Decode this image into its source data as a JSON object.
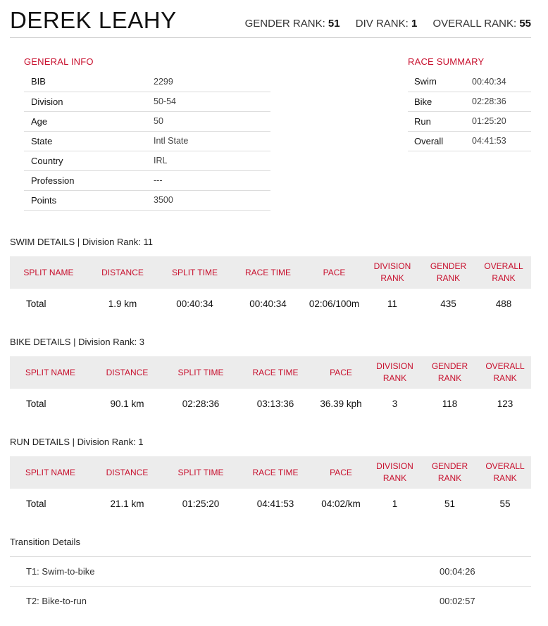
{
  "athlete": {
    "name": "DEREK LEAHY",
    "gender_rank_label": "GENDER RANK:",
    "gender_rank": "51",
    "div_rank_label": "DIV RANK:",
    "div_rank": "1",
    "overall_rank_label": "OVERALL RANK:",
    "overall_rank": "55"
  },
  "general_info": {
    "title": "GENERAL INFO",
    "rows": [
      {
        "label": "BIB",
        "value": "2299"
      },
      {
        "label": "Division",
        "value": "50-54"
      },
      {
        "label": "Age",
        "value": "50"
      },
      {
        "label": "State",
        "value": "Intl State"
      },
      {
        "label": "Country",
        "value": "IRL"
      },
      {
        "label": "Profession",
        "value": "---"
      },
      {
        "label": "Points",
        "value": "3500"
      }
    ]
  },
  "race_summary": {
    "title": "RACE SUMMARY",
    "rows": [
      {
        "label": "Swim",
        "value": "00:40:34"
      },
      {
        "label": "Bike",
        "value": "02:28:36"
      },
      {
        "label": "Run",
        "value": "01:25:20"
      },
      {
        "label": "Overall",
        "value": "04:41:53"
      }
    ]
  },
  "swim": {
    "heading": "SWIM DETAILS",
    "division_rank_label": "Division Rank: 11",
    "headers": [
      "SPLIT NAME",
      "DISTANCE",
      "SPLIT TIME",
      "RACE TIME",
      "PACE",
      "DIVISION RANK",
      "GENDER RANK",
      "OVERALL RANK"
    ],
    "row": [
      "Total",
      "1.9 km",
      "00:40:34",
      "00:40:34",
      "02:06/100m",
      "11",
      "435",
      "488"
    ]
  },
  "bike": {
    "heading": "BIKE DETAILS",
    "division_rank_label": "Division Rank: 3",
    "headers": [
      "SPLIT NAME",
      "DISTANCE",
      "SPLIT TIME",
      "RACE TIME",
      "PACE",
      "DIVISION RANK",
      "GENDER RANK",
      "OVERALL RANK"
    ],
    "row": [
      "Total",
      "90.1 km",
      "02:28:36",
      "03:13:36",
      "36.39 kph",
      "3",
      "118",
      "123"
    ]
  },
  "run": {
    "heading": "RUN DETAILS",
    "division_rank_label": "Division Rank: 1",
    "headers": [
      "SPLIT NAME",
      "DISTANCE",
      "SPLIT TIME",
      "RACE TIME",
      "PACE",
      "DIVISION RANK",
      "GENDER RANK",
      "OVERALL RANK"
    ],
    "row": [
      "Total",
      "21.1 km",
      "01:25:20",
      "04:41:53",
      "04:02/km",
      "1",
      "51",
      "55"
    ]
  },
  "transitions": {
    "heading": "Transition Details",
    "rows": [
      {
        "label": "T1: Swim-to-bike",
        "time": "00:04:26"
      },
      {
        "label": "T2: Bike-to-run",
        "time": "00:02:57"
      }
    ]
  },
  "colors": {
    "accent": "#c8102e",
    "header_row_bg": "#ececec",
    "divider": "#dcdcdc"
  }
}
